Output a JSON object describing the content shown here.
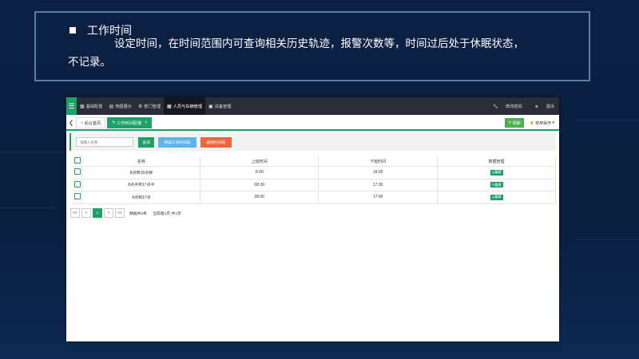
{
  "caption": {
    "title": "工作时间",
    "line1": "设定时间，在时间范围内可查询相关历史轨迹，报警次数等，时间过后处于休眠状态，",
    "line2": "不记录。"
  },
  "app": {
    "nav": [
      {
        "label": "基础配置",
        "icon": "grid-icon"
      },
      {
        "label": "地图展示",
        "icon": "map-icon"
      },
      {
        "label": "部门管理",
        "icon": "gear-icon"
      },
      {
        "label": "人员与车辆管理",
        "icon": "grid-icon",
        "active": true
      },
      {
        "label": "设备管理",
        "icon": "device-icon"
      }
    ],
    "top_right": {
      "change_password": "修改密码",
      "logout": "退出"
    },
    "tabs": {
      "home": "后台首页",
      "current": "工作时间配置"
    },
    "refresh": "刷新",
    "ops": "常用操作",
    "toolbar": {
      "search_placeholder": "请输入名称",
      "query": "查询",
      "add": "添加工作时间段",
      "delete": "删除时间段",
      "colors": {
        "query": "#1fa067",
        "add": "#5fb4e8",
        "delete": "#f2653c"
      }
    },
    "table": {
      "headers": [
        "名称",
        "上班时间",
        "下班时间",
        "数据管理"
      ],
      "rows": [
        {
          "name": "8点到18点钟",
          "start": "8:00",
          "end": "18:00",
          "action": "编辑"
        },
        {
          "name": "8点半到17点半",
          "start": "08:30",
          "end": "17:30",
          "action": "编辑"
        },
        {
          "name": "8点到17点",
          "start": "08:00",
          "end": "17:00",
          "action": "编辑"
        }
      ]
    },
    "pager": {
      "first": "<<",
      "prev": "<",
      "current": "1",
      "next": ">",
      "last": ">>",
      "total": "数据共3条",
      "page": "当前第1页 共1页"
    }
  }
}
